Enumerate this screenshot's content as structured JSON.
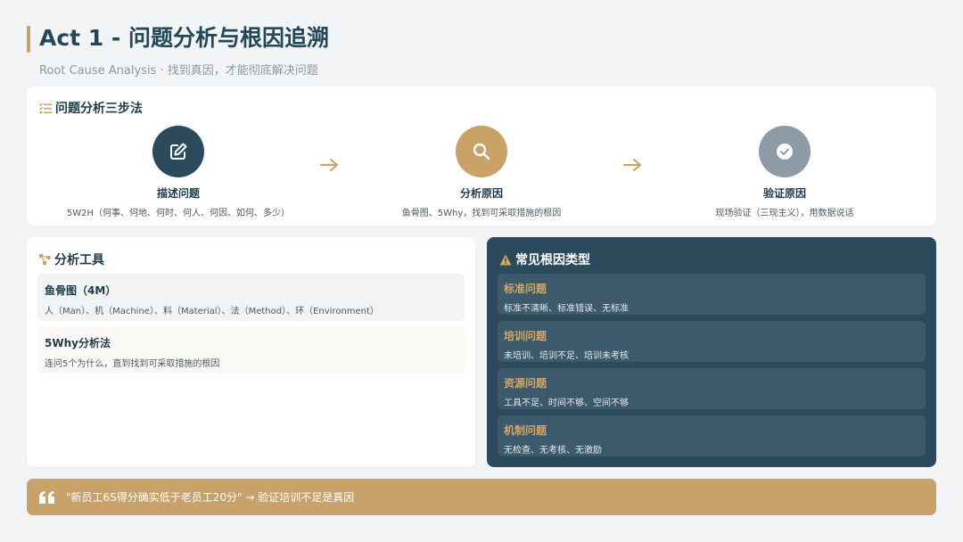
{
  "header": {
    "title": "Act 1 - 问题分析与根因追溯",
    "subtitle": "Root Cause Analysis · 找到真因，才能彻底解决问题"
  },
  "steps_section": {
    "title": "问题分析三步法",
    "icon": "checklist-icon",
    "steps": [
      {
        "name": "描述问题",
        "desc": "5W2H（何事、何地、何时、何人、何因、如何、多少）",
        "icon": "edit-icon",
        "color": "#2b4a5c"
      },
      {
        "name": "分析原因",
        "desc": "鱼骨图、5Why，找到可采取措施的根因",
        "icon": "search-icon",
        "color": "#c9a266"
      },
      {
        "name": "验证原因",
        "desc": "现场验证（三现主义），用数据说话",
        "icon": "check-circle-icon",
        "color": "#8d9ba6"
      }
    ],
    "arrow_icon": "arrow-right-icon"
  },
  "tools_section": {
    "title": "分析工具",
    "icon": "sitemap-icon",
    "tools": [
      {
        "name": "鱼骨图（4M）",
        "desc": "人（Man）、机（Machine）、料（Material）、法（Method）、环（Environment）"
      },
      {
        "name": "5Why分析法",
        "desc": "连问5个为什么，直到找到可采取措施的根因"
      }
    ]
  },
  "types_section": {
    "title": "常见根因类型",
    "icon": "warning-icon",
    "types": [
      {
        "name": "标准问题",
        "desc": "标准不清晰、标准错误、无标准"
      },
      {
        "name": "培训问题",
        "desc": "未培训、培训不足、培训未考核"
      },
      {
        "name": "资源问题",
        "desc": "工具不足、时间不够、空间不够"
      },
      {
        "name": "机制问题",
        "desc": "无检查、无考核、无激励"
      }
    ]
  },
  "quote": {
    "icon": "quote-icon",
    "text": "\"新员工6S得分确实低于老员工20分\" → 验证培训不足是真因"
  },
  "colors": {
    "navy": "#2b4a5c",
    "gold": "#c9a266",
    "gray": "#8d9ba6"
  }
}
